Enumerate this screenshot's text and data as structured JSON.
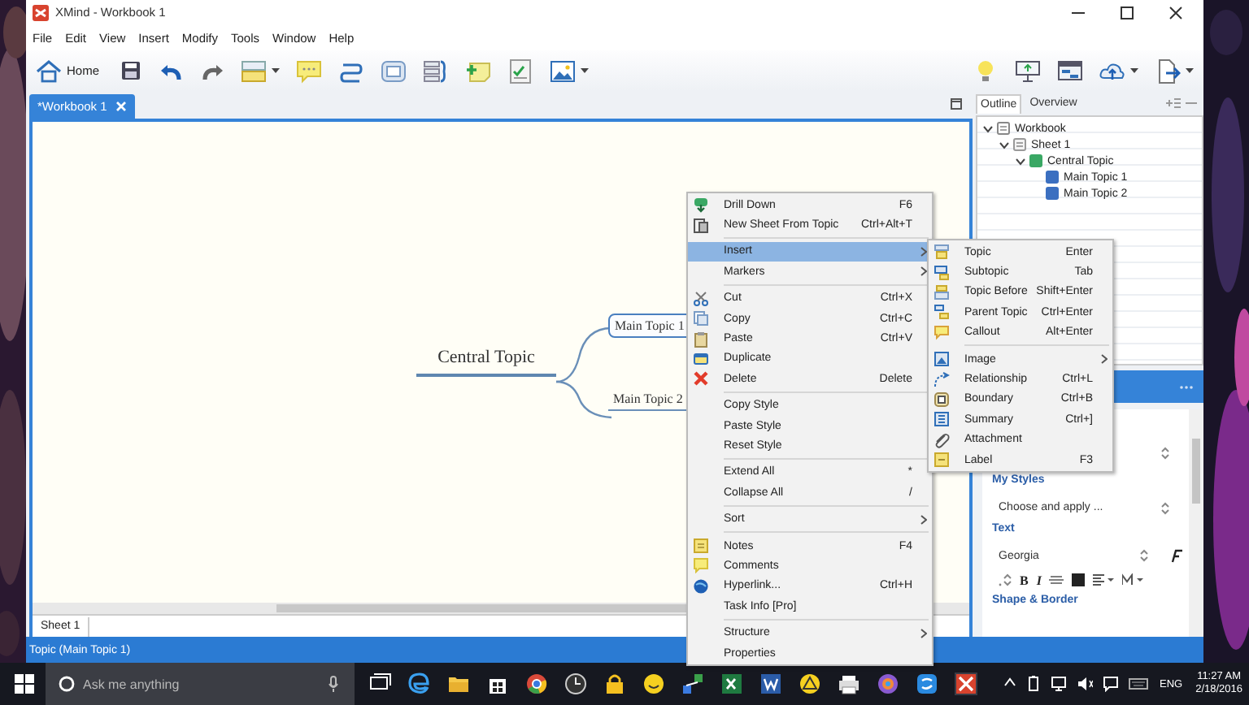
{
  "window": {
    "title": "XMind - Workbook 1"
  },
  "menu": [
    "File",
    "Edit",
    "View",
    "Insert",
    "Modify",
    "Tools",
    "Window",
    "Help"
  ],
  "toolbar": {
    "home_label": "Home"
  },
  "editor_tab": {
    "label": "*Workbook 1",
    "selected": true
  },
  "map": {
    "central": "Central Topic",
    "topics": [
      {
        "label": "Main Topic 1",
        "selected": true
      },
      {
        "label": "Main Topic 2",
        "selected": false
      }
    ]
  },
  "sheet_tab": "Sheet 1",
  "status_bar": "Topic (Main Topic 1)",
  "outline": {
    "tabs": [
      {
        "label": "Outline",
        "selected": true
      },
      {
        "label": "Overview",
        "selected": false
      }
    ],
    "tree": [
      {
        "label": "Workbook",
        "kind": "workbook",
        "expanded": true,
        "children": [
          {
            "label": "Sheet 1",
            "kind": "sheet",
            "expanded": true,
            "children": [
              {
                "label": "Central Topic",
                "kind": "central",
                "expanded": true,
                "children": [
                  {
                    "label": "Main Topic 1",
                    "kind": "main"
                  },
                  {
                    "label": "Main Topic 2",
                    "kind": "main"
                  }
                ]
              }
            ]
          }
        ]
      }
    ]
  },
  "format": {
    "my_styles": "My Styles",
    "style_select": "Choose and apply ...",
    "text": "Text",
    "font_select": "Georgia",
    "text_buttons": [
      "B",
      "I"
    ],
    "shape_border": "Shape & Border"
  },
  "context_menu": {
    "items": [
      {
        "kind": "item",
        "label": "Drill Down",
        "shortcut": "F6",
        "submenu": false,
        "selected": false
      },
      {
        "kind": "item",
        "label": "New Sheet From Topic",
        "shortcut": "Ctrl+Alt+T",
        "submenu": false,
        "selected": false
      },
      {
        "kind": "separator"
      },
      {
        "kind": "item",
        "label": "Insert",
        "submenu": true,
        "selected": true
      },
      {
        "kind": "item",
        "label": "Markers",
        "submenu": true,
        "selected": false
      },
      {
        "kind": "separator"
      },
      {
        "kind": "item",
        "label": "Cut",
        "shortcut": "Ctrl+X",
        "submenu": false,
        "selected": false
      },
      {
        "kind": "item",
        "label": "Copy",
        "shortcut": "Ctrl+C",
        "submenu": false,
        "selected": false
      },
      {
        "kind": "item",
        "label": "Paste",
        "shortcut": "Ctrl+V",
        "submenu": false,
        "selected": false
      },
      {
        "kind": "item",
        "label": "Duplicate",
        "submenu": false,
        "selected": false
      },
      {
        "kind": "item",
        "label": "Delete",
        "shortcut": "Delete",
        "submenu": false,
        "selected": false
      },
      {
        "kind": "separator"
      },
      {
        "kind": "item",
        "label": "Copy Style",
        "submenu": false,
        "selected": false
      },
      {
        "kind": "item",
        "label": "Paste Style",
        "submenu": false,
        "selected": false
      },
      {
        "kind": "item",
        "label": "Reset Style",
        "submenu": false,
        "selected": false
      },
      {
        "kind": "separator"
      },
      {
        "kind": "item",
        "label": "Extend All",
        "shortcut": "*",
        "submenu": false,
        "selected": false
      },
      {
        "kind": "item",
        "label": "Collapse All",
        "shortcut": "/",
        "submenu": false,
        "selected": false
      },
      {
        "kind": "separator"
      },
      {
        "kind": "item",
        "label": "Sort",
        "submenu": true,
        "selected": false
      },
      {
        "kind": "separator"
      },
      {
        "kind": "item",
        "label": "Notes",
        "shortcut": "F4",
        "submenu": false,
        "selected": false
      },
      {
        "kind": "item",
        "label": "Comments",
        "submenu": false,
        "selected": false
      },
      {
        "kind": "item",
        "label": "Hyperlink...",
        "shortcut": "Ctrl+H",
        "submenu": false,
        "selected": false
      },
      {
        "kind": "item",
        "label": "Task Info [Pro]",
        "submenu": false,
        "selected": false
      },
      {
        "kind": "separator"
      },
      {
        "kind": "item",
        "label": "Structure",
        "submenu": true,
        "selected": false
      },
      {
        "kind": "item",
        "label": "Properties",
        "submenu": false,
        "selected": false
      }
    ]
  },
  "submenu": {
    "items": [
      {
        "kind": "item",
        "label": "Topic",
        "shortcut": "Enter",
        "submenu": false
      },
      {
        "kind": "item",
        "label": "Subtopic",
        "shortcut": "Tab",
        "submenu": false
      },
      {
        "kind": "item",
        "label": "Topic Before",
        "shortcut": "Shift+Enter",
        "submenu": false
      },
      {
        "kind": "item",
        "label": "Parent Topic",
        "shortcut": "Ctrl+Enter",
        "submenu": false
      },
      {
        "kind": "item",
        "label": "Callout",
        "shortcut": "Alt+Enter",
        "submenu": false
      },
      {
        "kind": "separator"
      },
      {
        "kind": "item",
        "label": "Image",
        "submenu": true
      },
      {
        "kind": "item",
        "label": "Relationship",
        "shortcut": "Ctrl+L",
        "submenu": false
      },
      {
        "kind": "item",
        "label": "Boundary",
        "shortcut": "Ctrl+B",
        "submenu": false
      },
      {
        "kind": "item",
        "label": "Summary",
        "shortcut": "Ctrl+]",
        "submenu": false
      },
      {
        "kind": "item",
        "label": "Attachment",
        "submenu": false
      },
      {
        "kind": "item",
        "label": "Label",
        "shortcut": "F3",
        "submenu": false
      }
    ]
  },
  "taskbar": {
    "search_placeholder": "Ask me anything",
    "language": "ENG",
    "time": "11:27 AM",
    "date": "2/18/2016"
  }
}
